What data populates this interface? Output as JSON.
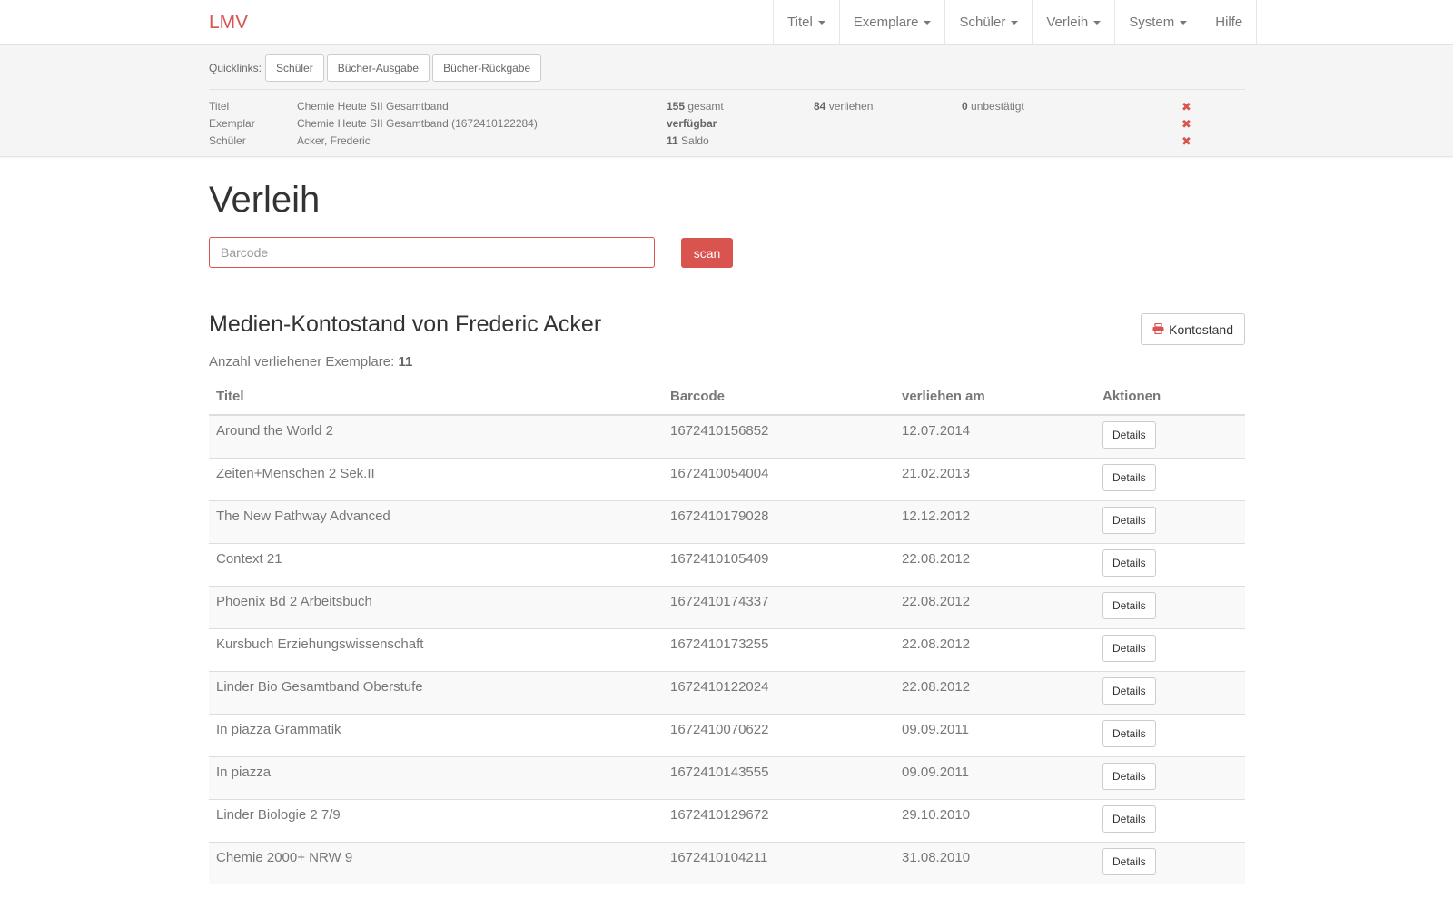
{
  "navbar": {
    "brand": "LMV",
    "items": [
      {
        "label": "Titel",
        "dropdown": true
      },
      {
        "label": "Exemplare",
        "dropdown": true
      },
      {
        "label": "Schüler",
        "dropdown": true
      },
      {
        "label": "Verleih",
        "dropdown": true
      },
      {
        "label": "System",
        "dropdown": true
      },
      {
        "label": "Hilfe",
        "dropdown": false
      }
    ]
  },
  "quicklinks": {
    "label": "Quicklinks:",
    "buttons": [
      "Schüler",
      "Bücher-Ausgabe",
      "Bücher-Rückgabe"
    ]
  },
  "info": {
    "titel": {
      "label": "Titel",
      "value": "Chemie Heute SII Gesamtband",
      "total_num": "155",
      "total_text": "gesamt",
      "lent_num": "84",
      "lent_text": "verliehen",
      "unconf_num": "0",
      "unconf_text": "unbestätigt"
    },
    "exemplar": {
      "label": "Exemplar",
      "value": "Chemie Heute SII Gesamtband (1672410122284)",
      "status": "verfügbar"
    },
    "schueler": {
      "label": "Schüler",
      "value": "Acker, Frederic",
      "saldo_num": "11",
      "saldo_text": "Saldo"
    },
    "remove_icon": "✖"
  },
  "main": {
    "title": "Verleih",
    "barcode_placeholder": "Barcode",
    "scan_label": "scan",
    "section_title": "Medien-Kontostand von Frederic Acker",
    "konto_button": "Kontostand",
    "count_label": "Anzahl verliehener Exemplare:",
    "count_value": "11"
  },
  "table": {
    "headers": [
      "Titel",
      "Barcode",
      "verliehen am",
      "Aktionen"
    ],
    "details_label": "Details",
    "rows": [
      {
        "titel": "Around the World 2",
        "barcode": "1672410156852",
        "date": "12.07.2014"
      },
      {
        "titel": "Zeiten+Menschen 2 Sek.II",
        "barcode": "1672410054004",
        "date": "21.02.2013"
      },
      {
        "titel": "The New Pathway Advanced",
        "barcode": "1672410179028",
        "date": "12.12.2012"
      },
      {
        "titel": "Context 21",
        "barcode": "1672410105409",
        "date": "22.08.2012"
      },
      {
        "titel": "Phoenix Bd 2 Arbeitsbuch",
        "barcode": "1672410174337",
        "date": "22.08.2012"
      },
      {
        "titel": "Kursbuch Erziehungswissenschaft",
        "barcode": "1672410173255",
        "date": "22.08.2012"
      },
      {
        "titel": "Linder Bio Gesamtband Oberstufe",
        "barcode": "1672410122024",
        "date": "22.08.2012"
      },
      {
        "titel": "In piazza Grammatik",
        "barcode": "1672410070622",
        "date": "09.09.2011"
      },
      {
        "titel": "In piazza",
        "barcode": "1672410143555",
        "date": "09.09.2011"
      },
      {
        "titel": "Linder Biologie 2 7/9",
        "barcode": "1672410129672",
        "date": "29.10.2010"
      },
      {
        "titel": "Chemie 2000+ NRW 9",
        "barcode": "1672410104211",
        "date": "31.08.2010"
      }
    ]
  },
  "colors": {
    "accent": "#d9534f",
    "text": "#777777",
    "heading": "#333333"
  }
}
